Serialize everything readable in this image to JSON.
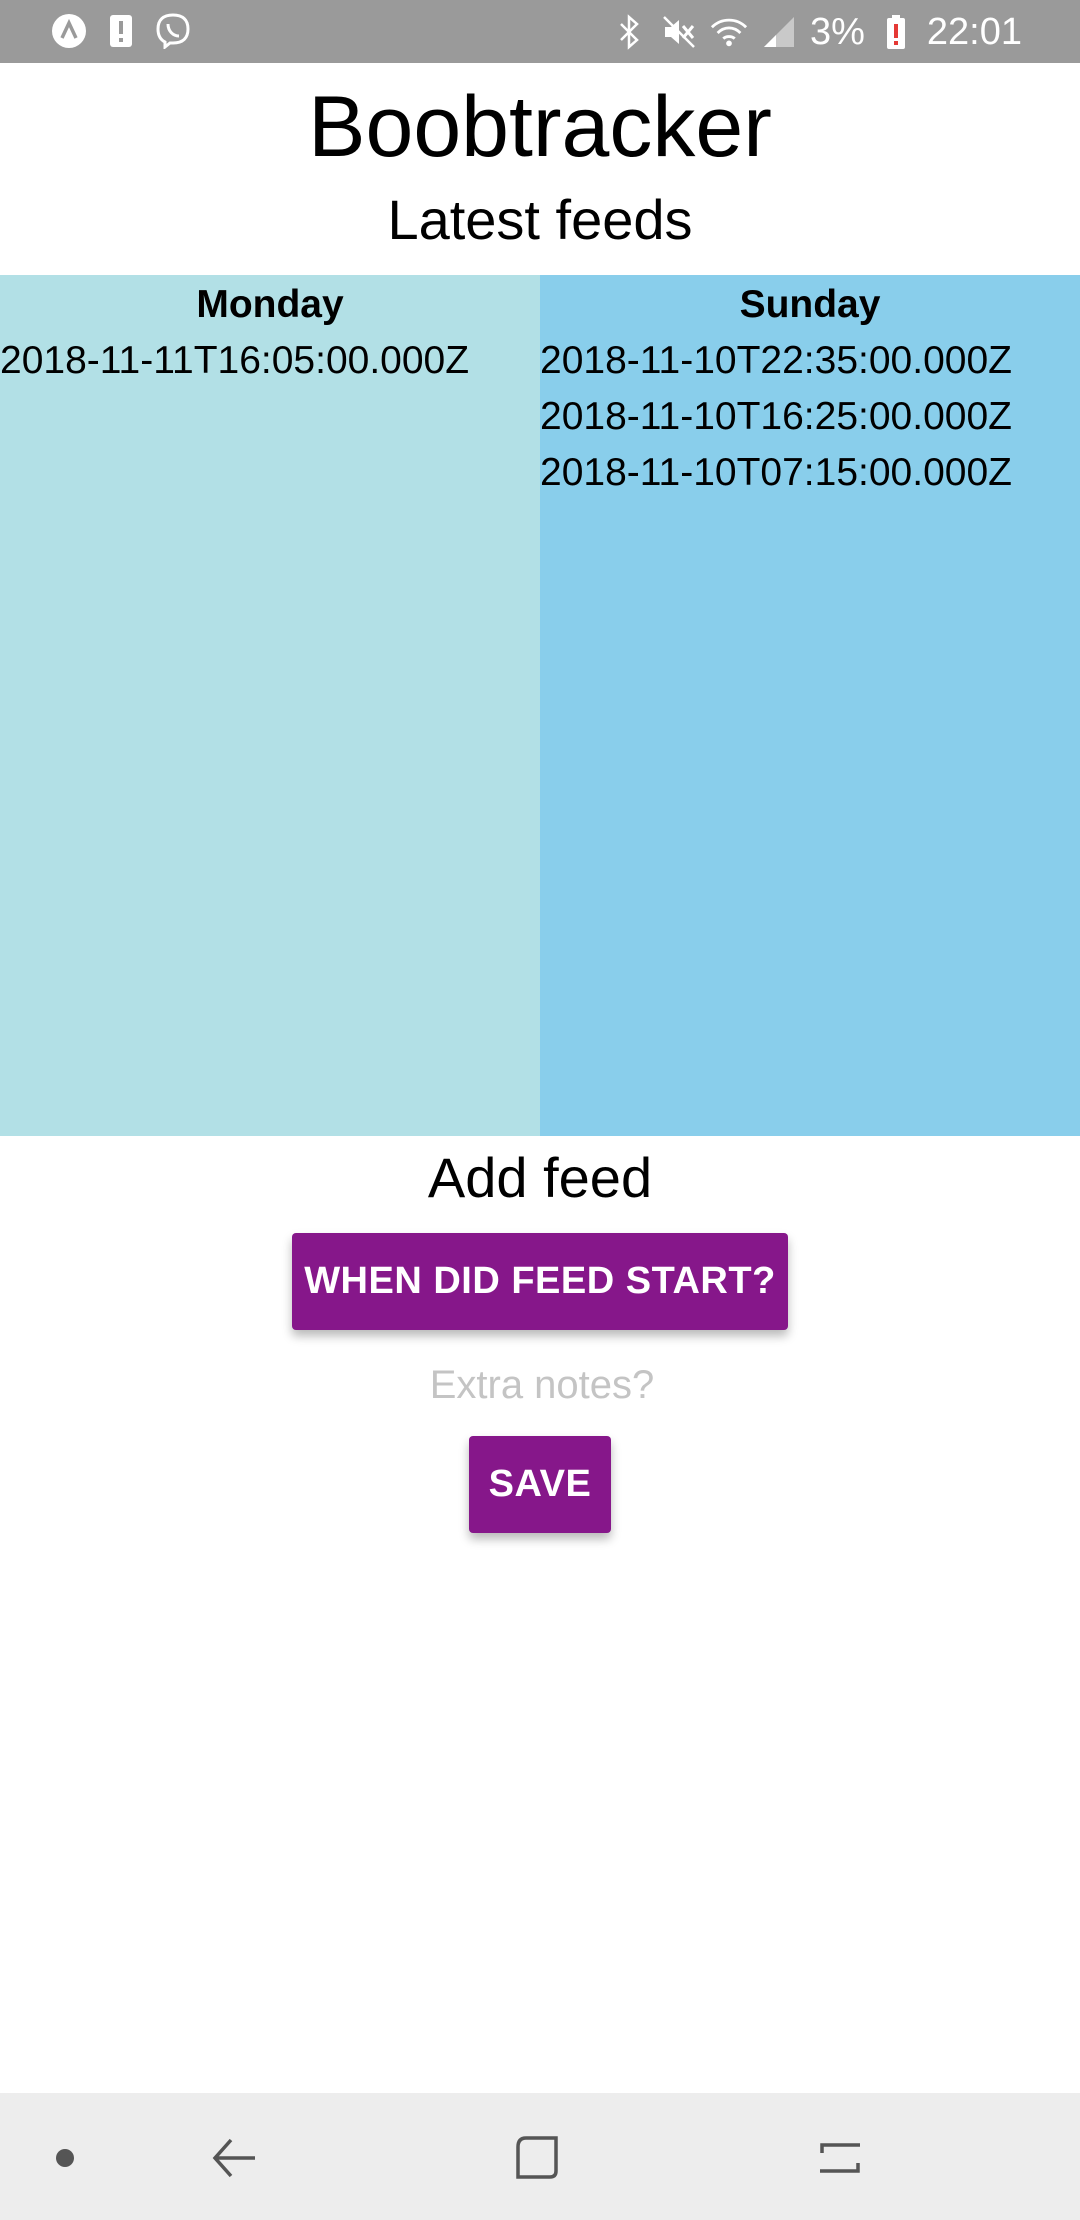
{
  "status_bar": {
    "left_icons": [
      "assistant-icon",
      "alert-icon",
      "viber-icon"
    ],
    "right_icons": [
      "bluetooth-icon",
      "mute-icon",
      "wifi-icon",
      "signal-icon"
    ],
    "battery_percent": "3%",
    "time": "22:01"
  },
  "header": {
    "title": "Boobtracker",
    "subtitle": "Latest feeds"
  },
  "feeds": {
    "days": [
      {
        "name": "Monday",
        "entries": [
          "2018-11-11T16:05:00.000Z"
        ]
      },
      {
        "name": "Sunday",
        "entries": [
          "2018-11-10T22:35:00.000Z",
          "2018-11-10T16:25:00.000Z",
          "2018-11-10T07:15:00.000Z"
        ]
      }
    ]
  },
  "add_feed": {
    "title": "Add feed",
    "start_button_label": "WHEN DID FEED START?",
    "notes_placeholder": "Extra notes?",
    "notes_value": "",
    "save_button_label": "SAVE"
  },
  "colors": {
    "monday_bg": "#b2e0e6",
    "sunday_bg": "#89ceeb",
    "button_accent": "#86178a"
  },
  "nav_bar": {
    "icons": [
      "dot-icon",
      "back-icon",
      "home-icon",
      "recents-icon"
    ]
  }
}
